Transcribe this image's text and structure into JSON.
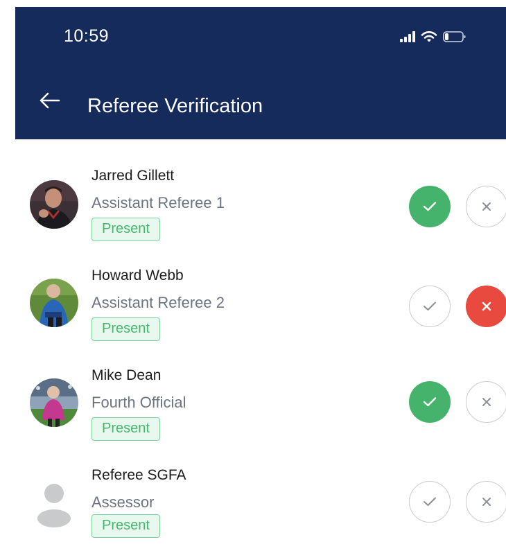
{
  "status_bar": {
    "time": "10:59"
  },
  "header": {
    "title": "Referee Verification"
  },
  "officials": [
    {
      "name": "Jarred Gillett",
      "role": "Assistant Referee 1",
      "status": "Present",
      "verified": "approve"
    },
    {
      "name": "Howard Webb",
      "role": "Assistant Referee 2",
      "status": "Present",
      "verified": "reject"
    },
    {
      "name": "Mike Dean",
      "role": "Fourth Official",
      "status": "Present",
      "verified": "approve"
    },
    {
      "name": "Referee SGFA",
      "role": "Assessor",
      "status": "Present",
      "verified": "none"
    }
  ],
  "colors": {
    "header": "#152b5c",
    "approve": "#46b36c",
    "reject": "#e84a3f",
    "badge_text": "#46b86d"
  }
}
